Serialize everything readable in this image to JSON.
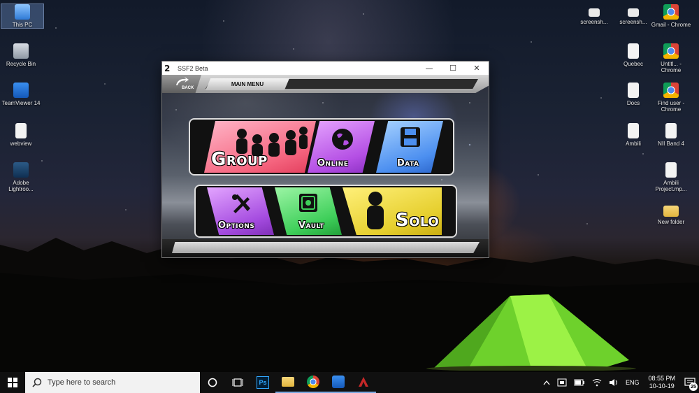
{
  "desktop": {
    "left_icons": [
      {
        "label": "This PC",
        "icon": "computer-icon"
      },
      {
        "label": "Recycle Bin",
        "icon": "recycle-bin-icon"
      },
      {
        "label": "TeamViewer 14",
        "icon": "teamviewer-icon"
      },
      {
        "label": "webview",
        "icon": "file-icon"
      },
      {
        "label": "Adobe Lightroo...",
        "icon": "lightroom-icon"
      }
    ],
    "right_icons": [
      {
        "label": "screensh...",
        "icon": "screenshot-icon"
      },
      {
        "label": "screensh...",
        "icon": "screenshot-icon"
      },
      {
        "label": "Gmail - Chrome",
        "icon": "chrome-icon"
      },
      {
        "label": "Quebec",
        "icon": "file-icon"
      },
      {
        "label": "Untitl... - Chrome",
        "icon": "chrome-icon"
      },
      {
        "label": "Docs",
        "icon": "file-icon"
      },
      {
        "label": "Find user - Chrome",
        "icon": "chrome-icon"
      },
      {
        "label": "Ambili",
        "icon": "file-icon"
      },
      {
        "label": "NII Band 4",
        "icon": "file-icon"
      },
      {
        "label": "Ambili Project.mp...",
        "icon": "file-icon"
      },
      {
        "label": "New folder",
        "icon": "folder-icon"
      }
    ]
  },
  "window": {
    "title": "SSF2 Beta",
    "app_logo": "2",
    "minimize": "—",
    "maximize": "☐",
    "close": "✕"
  },
  "game": {
    "back_label": "BACK",
    "menu_title": "MAIN MENU",
    "tiles": {
      "group": "Group",
      "online": "Online",
      "data": "Data",
      "options": "Options",
      "vault": "Vault",
      "solo": "Solo"
    }
  },
  "taskbar": {
    "search_placeholder": "Type here to search",
    "apps": [
      {
        "name": "cortana-icon"
      },
      {
        "name": "task-view-icon"
      },
      {
        "name": "photoshop-icon",
        "label": "Ps"
      },
      {
        "name": "file-explorer-icon"
      },
      {
        "name": "chrome-icon"
      },
      {
        "name": "teamviewer-icon"
      },
      {
        "name": "ssf2-icon"
      }
    ],
    "tray": {
      "language": "ENG",
      "time": "08:55 PM",
      "date": "10-10-19",
      "notifications": "25"
    }
  }
}
